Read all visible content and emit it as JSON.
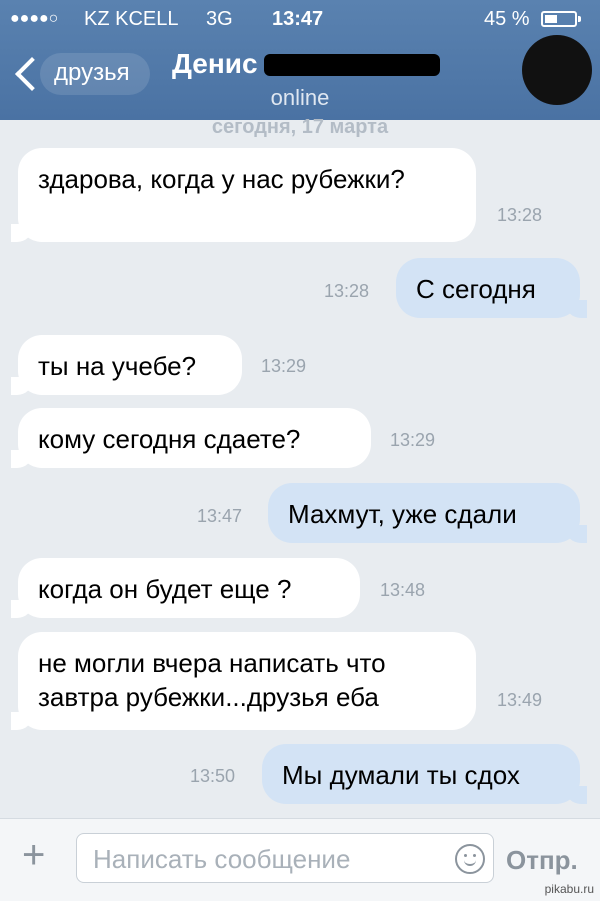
{
  "status_bar": {
    "signal": "●●●●○",
    "carrier": "KZ KCELL",
    "network": "3G",
    "time": "13:47",
    "battery": "45 %",
    "battery_level": 0.45
  },
  "header": {
    "back_label": "друзья",
    "contact_name": "Денис",
    "contact_status": "online"
  },
  "date_label": "сегодня, 17 марта",
  "messages": [
    {
      "dir": "in",
      "text": "здарова, когда у нас рубежки?",
      "time": "13:28"
    },
    {
      "dir": "out",
      "text": "С сегодня",
      "time": "13:28"
    },
    {
      "dir": "in",
      "text": "ты на учебе?",
      "time": "13:29"
    },
    {
      "dir": "in",
      "text": "кому сегодня сдаете?",
      "time": "13:29"
    },
    {
      "dir": "out",
      "text": "Махмут, уже сдали",
      "time": "13:47"
    },
    {
      "dir": "in",
      "text": "когда он будет еще ?",
      "time": "13:48"
    },
    {
      "dir": "in",
      "text": "не могли вчера написать что завтра рубежки...друзья еба",
      "time": "13:49"
    },
    {
      "dir": "out",
      "text": "Мы думали ты сдох",
      "time": "13:50"
    }
  ],
  "composer": {
    "placeholder": "Написать сообщение",
    "send_label": "Отпр."
  },
  "watermark": "pikabu.ru",
  "colors": {
    "header": "#4a72a3",
    "incoming_bubble": "#ffffff",
    "outgoing_bubble": "#d3e3f5",
    "background": "#e8ecf0"
  }
}
